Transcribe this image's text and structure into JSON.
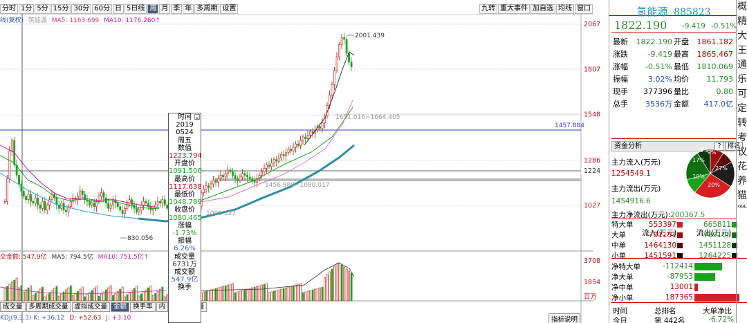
{
  "toolbar": {
    "periods": [
      "分时",
      "1分",
      "5分",
      "15分",
      "30分",
      "60分",
      "日",
      "5日线",
      "周",
      "月",
      "季",
      "年",
      "多周期",
      "设置"
    ],
    "active_index": 8,
    "right_items": [
      "九转",
      "重大事件",
      "加自选",
      "均线",
      "窗口"
    ]
  },
  "chart_header": {
    "prefix": "线(复权)",
    "mode": "筑能源",
    "ma5": "MA5: 1163.699",
    "ma10": "MA10: 1176.260↑"
  },
  "volume_header": {
    "label": "交金额: 547.9亿",
    "ma5": "MA5: 794.5亿",
    "ma10": "MA10: 751.5亿↑"
  },
  "kdj_header": {
    "label": "KDJ(9,3,3) K: +36.12",
    "d": "D: +52.63",
    "j": "J: +3.10"
  },
  "price_axis": [
    "2067",
    "1807",
    "1548",
    "1286",
    "1027"
  ],
  "price_axis_current": "1224",
  "volume_axis": [
    "3708",
    "1854",
    "百万"
  ],
  "annotations": {
    "high": "2001.439",
    "low": "830.056",
    "fib1": "1456.980~1080.017",
    "fib2": "1000.327",
    "fib_top": "1651.016~1664.405",
    "ref_line": "1457.884"
  },
  "info_box": {
    "rows": [
      "时间",
      "2019",
      "0524",
      "周五",
      "数值",
      "1223.794",
      "开盘价",
      "1091.506",
      "最高价",
      "1117.638",
      "最低价",
      "1048.789",
      "收盘价",
      "1080.465",
      "涨幅",
      "-1.73%",
      "振幅",
      "6.26%",
      "成交量",
      "6731万",
      "成交额",
      "547.9亿",
      "换手"
    ]
  },
  "bottom_tabs": [
    "成交量",
    "多周期成交量",
    "虚拟成交量",
    "金额",
    "换手率",
    "内",
    "",
    "后成交量"
  ],
  "bottom_active": 3,
  "bottom_right": "指标说明",
  "stock": {
    "name": "氢能源",
    "code": "885823",
    "price": "1822.190",
    "change": "-9.419",
    "change_pct": "-0.51%"
  },
  "quotes": [
    {
      "l1": "最新",
      "v1": "1822.190",
      "c1": "green",
      "l2": "开盘",
      "v2": "1861.182",
      "c2": "red"
    },
    {
      "l1": "涨跌",
      "v1": "-9.419",
      "c1": "green",
      "l2": "最高",
      "v2": "1865.467",
      "c2": "red"
    },
    {
      "l1": "涨幅",
      "v1": "-0.51%",
      "c1": "green",
      "l2": "最低",
      "v2": "1810.069",
      "c2": "green"
    },
    {
      "l1": "振幅",
      "v1": "3.02%",
      "c1": "blue",
      "l2": "均价",
      "v2": "11.793",
      "c2": "green"
    },
    {
      "l1": "现手",
      "v1": "377396",
      "c1": "",
      "l2": "量比",
      "v2": "0.80",
      "c2": "green"
    },
    {
      "l1": "总手",
      "v1": "3536万",
      "c1": "blue",
      "l2": "金额",
      "v2": "417.0亿",
      "c2": "blue"
    }
  ],
  "capital": {
    "title": "资金分析",
    "buttons": [
      "?",
      "排名"
    ],
    "inflow_label": "主力流入(万元)",
    "inflow_value": "1254549.1",
    "outflow_label": "主力流出(万元)",
    "outflow_value": "1454916.6",
    "net_label": "主力净流出(万元):",
    "net_value": "200367.5",
    "pie_labels": [
      "9%",
      "8%",
      "17%",
      "27%",
      "10%",
      "20%"
    ]
  },
  "flow_table": {
    "headers": [
      "流入(万元)",
      "流出(万元)"
    ],
    "rows": [
      {
        "label": "特大单",
        "in": "553397",
        "out": "665811"
      },
      {
        "label": "大单",
        "in": "701151",
        "out": "789105"
      },
      {
        "label": "中单",
        "in": "1464130",
        "out": "1451128"
      },
      {
        "label": "小单",
        "in": "1451591",
        "out": "1264225"
      }
    ]
  },
  "net_table": [
    {
      "label": "净特大单",
      "value": "-112414",
      "pct": 0.55,
      "color": "#19a319"
    },
    {
      "label": "净大单",
      "value": "-87953",
      "pct": 0.42,
      "color": "#19a319"
    },
    {
      "label": "净中单",
      "value": "13001",
      "pct": 0.07,
      "color": "#d42020"
    },
    {
      "label": "净小单",
      "value": "187365",
      "pct": 0.9,
      "color": "#d42020"
    }
  ],
  "rank_header": [
    "时间",
    "总排名",
    "大单净比"
  ],
  "rank_row": [
    "今日",
    "第 442名",
    "-6.72%"
  ],
  "sidebar_chars": [
    "概",
    "精",
    "大",
    "王",
    "通",
    "乐",
    "可",
    "定",
    "转",
    "考",
    "议",
    "花",
    "养",
    "猫",
    "微"
  ]
}
